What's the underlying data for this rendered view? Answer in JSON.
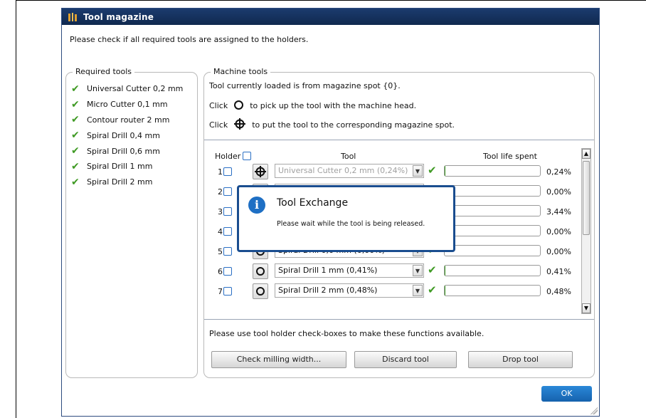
{
  "window": {
    "title": "Tool magazine"
  },
  "intro": "Please check if all required tools are assigned to the holders.",
  "required": {
    "legend": "Required tools",
    "items": [
      "Universal Cutter 0,2 mm",
      "Micro Cutter 0,1 mm",
      "Contour router 2 mm",
      "Spiral Drill   0,4 mm",
      "Spiral Drill   0,6 mm",
      "Spiral Drill   1 mm",
      "Spiral Drill   2 mm"
    ]
  },
  "machine": {
    "legend": "Machine tools",
    "loaded": "Tool currently loaded is from magazine spot {0}.",
    "click1": "Click",
    "hint1": "to pick up the tool with the machine head.",
    "click2": "Click",
    "hint2": "to put the tool to the corresponding magazine spot.",
    "col_holder": "Holder",
    "col_tool": "Tool",
    "col_life": "Tool life spent",
    "rows": [
      {
        "n": "1",
        "tool": "Universal Cutter 0,2 mm (0,24%)",
        "pct": "0,24%",
        "fill": 0.24
      },
      {
        "n": "2",
        "tool": "",
        "pct": "0,00%",
        "fill": 0
      },
      {
        "n": "3",
        "tool": "",
        "pct": "3,44%",
        "fill": 3.44
      },
      {
        "n": "4",
        "tool": "",
        "pct": "0,00%",
        "fill": 0
      },
      {
        "n": "5",
        "tool": "Spiral Drill   0,6 mm (0,00%)",
        "pct": "0,00%",
        "fill": 0
      },
      {
        "n": "6",
        "tool": "Spiral Drill   1 mm (0,41%)",
        "pct": "0,41%",
        "fill": 0.41
      },
      {
        "n": "7",
        "tool": "Spiral Drill   2 mm (0,48%)",
        "pct": "0,48%",
        "fill": 0.48
      }
    ],
    "footer_hint": "Please use tool holder check-boxes to make these functions available.",
    "btn_check": "Check milling width...",
    "btn_discard": "Discard tool",
    "btn_drop": "Drop tool"
  },
  "ok": "OK",
  "popup": {
    "title": "Tool Exchange",
    "message": "Please wait while the tool is being released."
  }
}
